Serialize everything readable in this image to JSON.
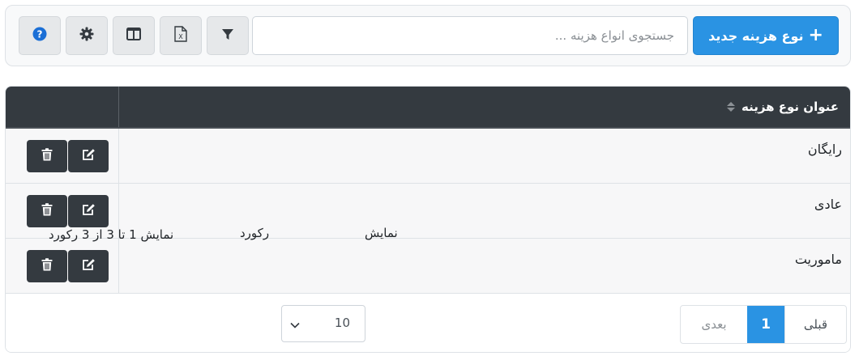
{
  "toolbar": {
    "add_button_label": "نوع هزینه جدید",
    "search_placeholder": "جستجوی انواع هزینه ...",
    "icons": [
      "plus-icon",
      "filter-icon",
      "excel-icon",
      "columns-icon",
      "gear-icon",
      "help-icon"
    ],
    "accent_color": "#2a93e3"
  },
  "table": {
    "column_title": "عنوان نوع هزینه",
    "rows": [
      {
        "title": "رایگان"
      },
      {
        "title": "عادی"
      },
      {
        "title": "ماموریت"
      }
    ],
    "header_color": "#343a40"
  },
  "pagination": {
    "prev_label": "قبلی",
    "current_page": "1",
    "next_label": "بعدی",
    "show_label": "نمایش",
    "page_size": "10",
    "records_label": "رکورد",
    "summary": "نمایش 1 تا 3 از 3 رکورد"
  }
}
